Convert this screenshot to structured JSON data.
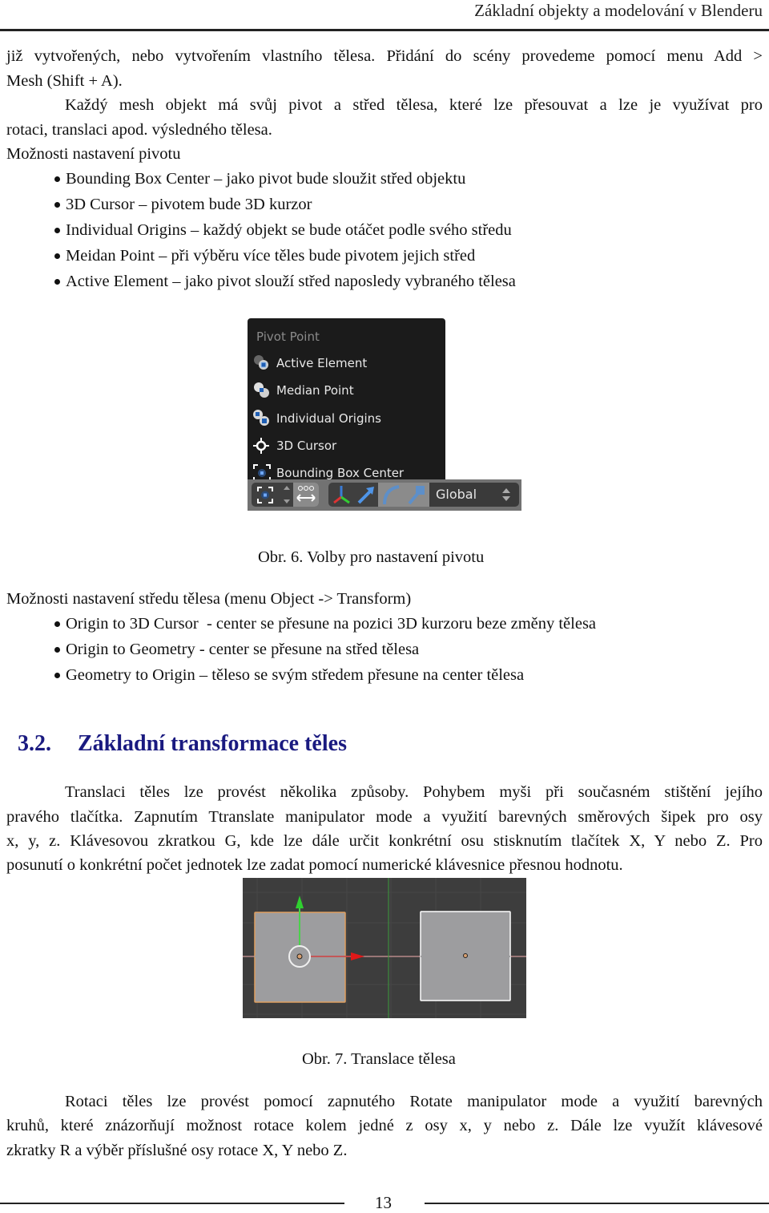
{
  "running_header": "Základní objekty a modelování v Blenderu",
  "intro": {
    "line1": "již vytvořených, nebo vytvořením vlastního tělesa. Přidání do scény provedeme pomocí menu Add >",
    "line2": "Mesh (Shift + A).",
    "para2_line1": "Každý mesh objekt má svůj pivot a střed tělesa, které lze přesouvat a lze je využívat pro",
    "para2_line2": "rotaci, translaci apod. výsledného tělesa."
  },
  "pivot_section": {
    "label": "Možnosti nastavení pivotu",
    "items": [
      "Bounding Box Center – jako pivot bude sloužit střed objektu",
      "3D Cursor – pivotem bude 3D kurzor",
      "Individual Origins – každý objekt se bude otáčet podle svého středu",
      "Meidan Point – při výběru více těles bude pivotem jejich střed",
      "Active Element – jako pivot slouží střed naposledy vybraného tělesa"
    ]
  },
  "figure6": {
    "menu_title": "Pivot Point",
    "menu_items": [
      {
        "label": "Active Element",
        "icon": "active-element-icon"
      },
      {
        "label": "Median Point",
        "icon": "median-point-icon"
      },
      {
        "label": "Individual Origins",
        "icon": "individual-origins-icon"
      },
      {
        "label": "3D Cursor",
        "icon": "cursor-3d-icon"
      },
      {
        "label": "Bounding Box Center",
        "icon": "bounding-box-center-icon"
      }
    ],
    "orientation_value": "Global",
    "caption": "Obr. 6. Volby pro nastavení pivotu"
  },
  "origin_section": {
    "label": "Možnosti nastavení středu tělesa (menu Object -> Transform)",
    "items": [
      "Origin to 3D Cursor  - center se přesune na pozici 3D kurzoru beze změny tělesa",
      "Origin to Geometry - center se přesune na střed tělesa",
      "Geometry to Origin – těleso se svým středem přesune na center tělesa"
    ]
  },
  "section_heading": {
    "number": "3.2.",
    "title": "Základní transformace těles",
    "color": "#1a1a80"
  },
  "translation_paragraph": {
    "lines": [
      "Translaci těles lze provést několika způsoby. Pohybem myši při současném stištění jejího",
      "pravého tlačítka. Zapnutím Ttranslate manipulator mode a využití barevných směrových šipek pro osy",
      "x, y, z. Klávesovou zkratkou G, kde lze dále určit konkrétní osu stisknutím tlačítek X, Y nebo Z. Pro",
      "posunutí o konkrétní počet jednotek lze zadat pomocí numerické klávesnice přesnou hodnotu."
    ]
  },
  "figure7": {
    "caption": "Obr. 7. Translace tělesa"
  },
  "rotation_paragraph": {
    "lines": [
      "Rotaci těles lze provést pomocí zapnutého Rotate manipulator mode a využití barevných",
      "kruhů, které znázorňují možnost rotace kolem jedné z osy x, y nebo z. Dále lze využít klávesové",
      "zkratky R a výběr příslušné osy rotace X, Y nebo Z."
    ]
  },
  "page_number": "13"
}
